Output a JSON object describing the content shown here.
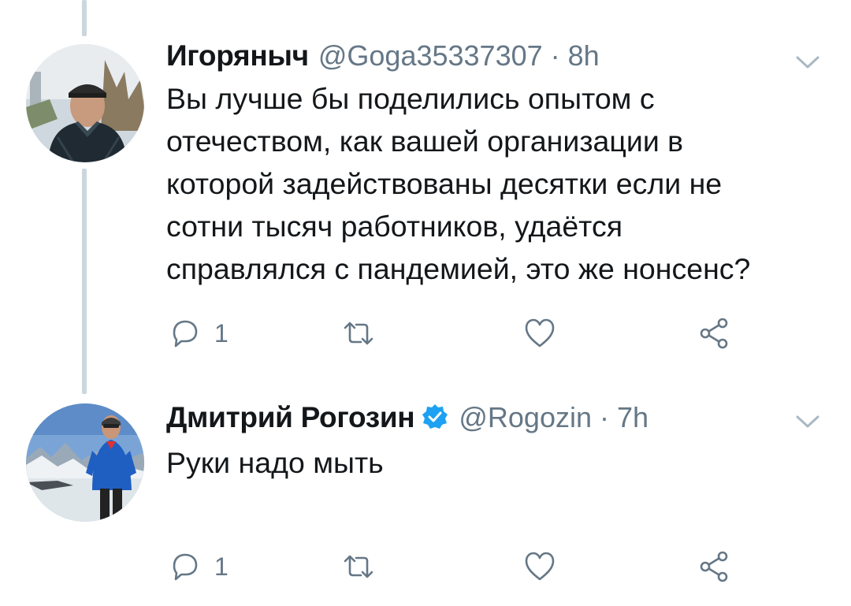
{
  "colors": {
    "text": "#14171a",
    "secondary": "#657786",
    "thread_line": "#ccd6dd",
    "verified_blue": "#1da1f2"
  },
  "tweets": [
    {
      "display_name": "Игоряныч",
      "handle_time": "@Goga35337307 · 8h",
      "verified": false,
      "avatar_icon": "avatar-photo-man-in-jacket",
      "body_lines": [
        "Вы лучше бы поделились опытом с",
        "отечеством, как вашей организации в",
        "которой задействованы десятки если не",
        "сотни тысяч работников, удаётся",
        "справлялся с пандемией, это же нонсенс?"
      ],
      "reply_count": "1",
      "icons": [
        "reply-icon",
        "retweet-icon",
        "like-icon",
        "share-icon",
        "chevron-down-icon"
      ]
    },
    {
      "display_name": "Дмитрий Рогозин",
      "handle_time": "@Rogozin · 7h",
      "verified": true,
      "avatar_icon": "avatar-photo-man-mountains",
      "body_lines": [
        "Руки надо мыть"
      ],
      "reply_count": "1",
      "icons": [
        "reply-icon",
        "retweet-icon",
        "like-icon",
        "share-icon",
        "chevron-down-icon"
      ]
    }
  ]
}
